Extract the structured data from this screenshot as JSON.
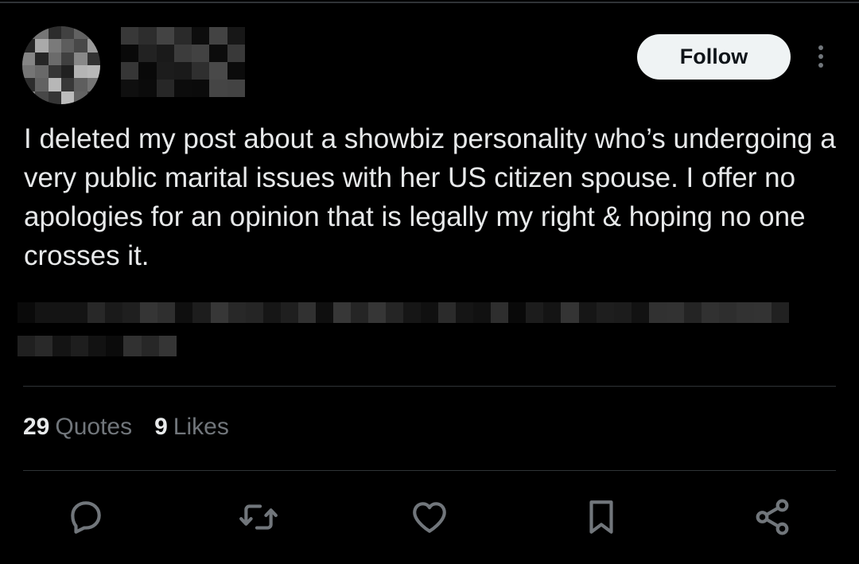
{
  "header": {
    "follow_label": "Follow",
    "more_icon": "more-vertical-icon"
  },
  "post": {
    "text": "I deleted my post about a showbiz personality who’s undergoing a very public marital issues with her US citizen spouse. I offer no apologies for an opinion that is legally my right & hoping no one crosses it."
  },
  "stats": {
    "quotes_count": "29",
    "quotes_label": "Quotes",
    "likes_count": "9",
    "likes_label": "Likes"
  },
  "actions": [
    "reply-icon",
    "repost-icon",
    "like-icon",
    "bookmark-icon",
    "share-icon"
  ],
  "colors": {
    "background": "#000000",
    "text": "#e7e9ea",
    "muted": "#71767b",
    "action_icon": "#71767b",
    "follow_bg": "#eff3f4",
    "follow_text": "#0f1419"
  }
}
